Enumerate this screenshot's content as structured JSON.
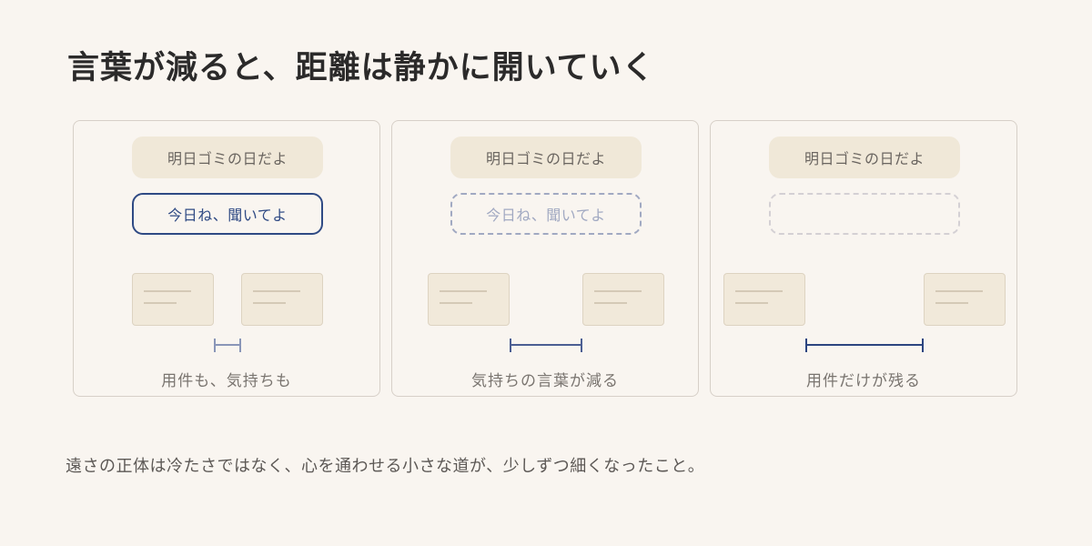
{
  "title": "言葉が減ると、距離は静かに開いていく",
  "panels": [
    {
      "top_bubble": "明日ゴミの日だよ",
      "reply_bubble": "今日ね、聞いてよ",
      "caption": "用件も、気持ちも",
      "gap_color": "#8a96b8"
    },
    {
      "top_bubble": "明日ゴミの日だよ",
      "reply_bubble": "今日ね、聞いてよ",
      "caption": "気持ちの言葉が減る",
      "gap_color": "#4c5f93"
    },
    {
      "top_bubble": "明日ゴミの日だよ",
      "reply_bubble": "",
      "caption": "用件だけが残る",
      "gap_color": "#2c4580"
    }
  ],
  "footer": "遠さの正体は冷たさではなく、心を通わせる小さな道が、少しずつ細くなったこと。",
  "colors": {
    "background": "#f9f5f0",
    "bubble_fill": "#f0e8d8",
    "reply_solid": "#2f4a84",
    "reply_dashed": "#a1a9c2",
    "reply_faint": "#d4d0d4",
    "card_fill": "#f1e9da"
  }
}
